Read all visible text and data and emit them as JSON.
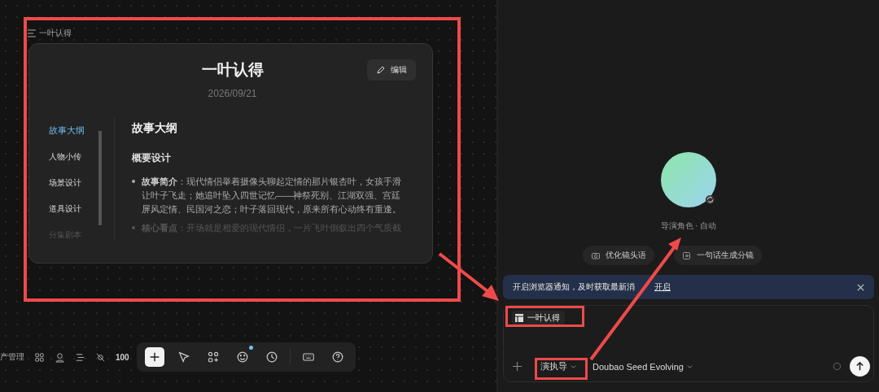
{
  "canvas": {
    "doc_label": "一叶认得",
    "card": {
      "title": "一叶认得",
      "edit_button": "编辑",
      "date": "2026/09/21",
      "chapters": [
        {
          "label": "故事大纲",
          "selected": true,
          "dimmed": false
        },
        {
          "label": "人物小传",
          "selected": false,
          "dimmed": false
        },
        {
          "label": "场景设计",
          "selected": false,
          "dimmed": false
        },
        {
          "label": "道具设计",
          "selected": false,
          "dimmed": false
        },
        {
          "label": "分集剧本",
          "selected": false,
          "dimmed": true
        }
      ],
      "section_title": "故事大纲",
      "subsection": "概要设计",
      "bullets": [
        {
          "label": "故事简介",
          "text": "：现代情侣举着摄像头聊起定情的那片银杏叶，女孩手滑让叶子飞走；她追叶坠入四世记忆——神祭死别、江湖双强、宫廷屏风定情、民国河之恋；叶子落回现代，原来所有心动终有重逢。",
          "dimmed": false
        },
        {
          "label": "核心看点",
          "text": "：开场就是相爱的现代情侣，一片飞叶倒叙出四个气质截",
          "dimmed": true
        }
      ]
    }
  },
  "bottom_bar": {
    "left_label": "产管理",
    "zoom": "100"
  },
  "tools": [
    {
      "kind": "add",
      "selected": true,
      "badge": false
    },
    {
      "kind": "pointer",
      "selected": false,
      "badge": false
    },
    {
      "kind": "apps",
      "selected": false,
      "badge": false
    },
    {
      "kind": "emoji",
      "selected": false,
      "badge": true
    },
    {
      "kind": "clock",
      "selected": false,
      "badge": false
    },
    {
      "kind": "keyboard",
      "selected": false,
      "badge": false
    },
    {
      "kind": "help",
      "selected": false,
      "badge": false
    }
  ],
  "assistant": {
    "role_label": "导演角色 · 自动",
    "suggestions": [
      {
        "kind": "camera",
        "label": "优化镜头语"
      },
      {
        "kind": "storyboard",
        "label": "一句话生成分镜"
      }
    ]
  },
  "notice": {
    "text": "开启浏览器通知，及时获取最新消",
    "link": "开启"
  },
  "composer": {
    "attachment": "一叶认得",
    "mode": "演执导",
    "model": "Doubao Seed Evolving"
  }
}
